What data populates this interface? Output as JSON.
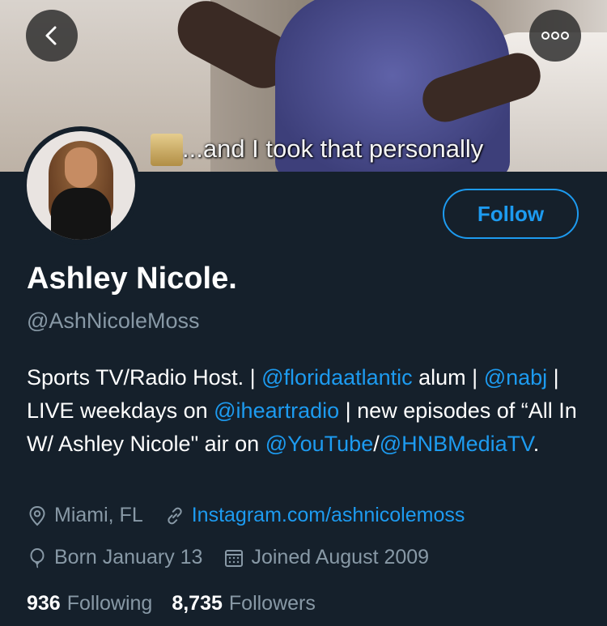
{
  "banner": {
    "caption": "...and I took that personally"
  },
  "nav": {
    "back_icon": "chevron-left-icon",
    "more_icon": "more-dots-icon"
  },
  "profile": {
    "name": "Ashley Nicole.",
    "handle": "@AshNicoleMoss",
    "follow_label": "Follow"
  },
  "bio": {
    "p1": "Sports TV/Radio Host. | ",
    "l1": "@floridaatlantic",
    "p2": " alum | ",
    "l2": "@nabj",
    "p3": " | LIVE weekdays on ",
    "l3": "@iheartradio",
    "p4": " | new episodes of “All In W/ Ashley Nicole\" air on ",
    "l4": "@YouTube",
    "p5": "/",
    "l5": "@HNBMediaTV",
    "p6": "."
  },
  "meta": {
    "location": "Miami, FL",
    "website": "Instagram.com/ashnicolemoss",
    "birthday": "Born January 13",
    "joined": "Joined August 2009"
  },
  "stats": {
    "following_count": "936",
    "following_label": "Following",
    "followers_count": "8,735",
    "followers_label": "Followers"
  },
  "colors": {
    "background": "#15202b",
    "accent": "#1d9bf0",
    "muted": "#8899a6"
  }
}
